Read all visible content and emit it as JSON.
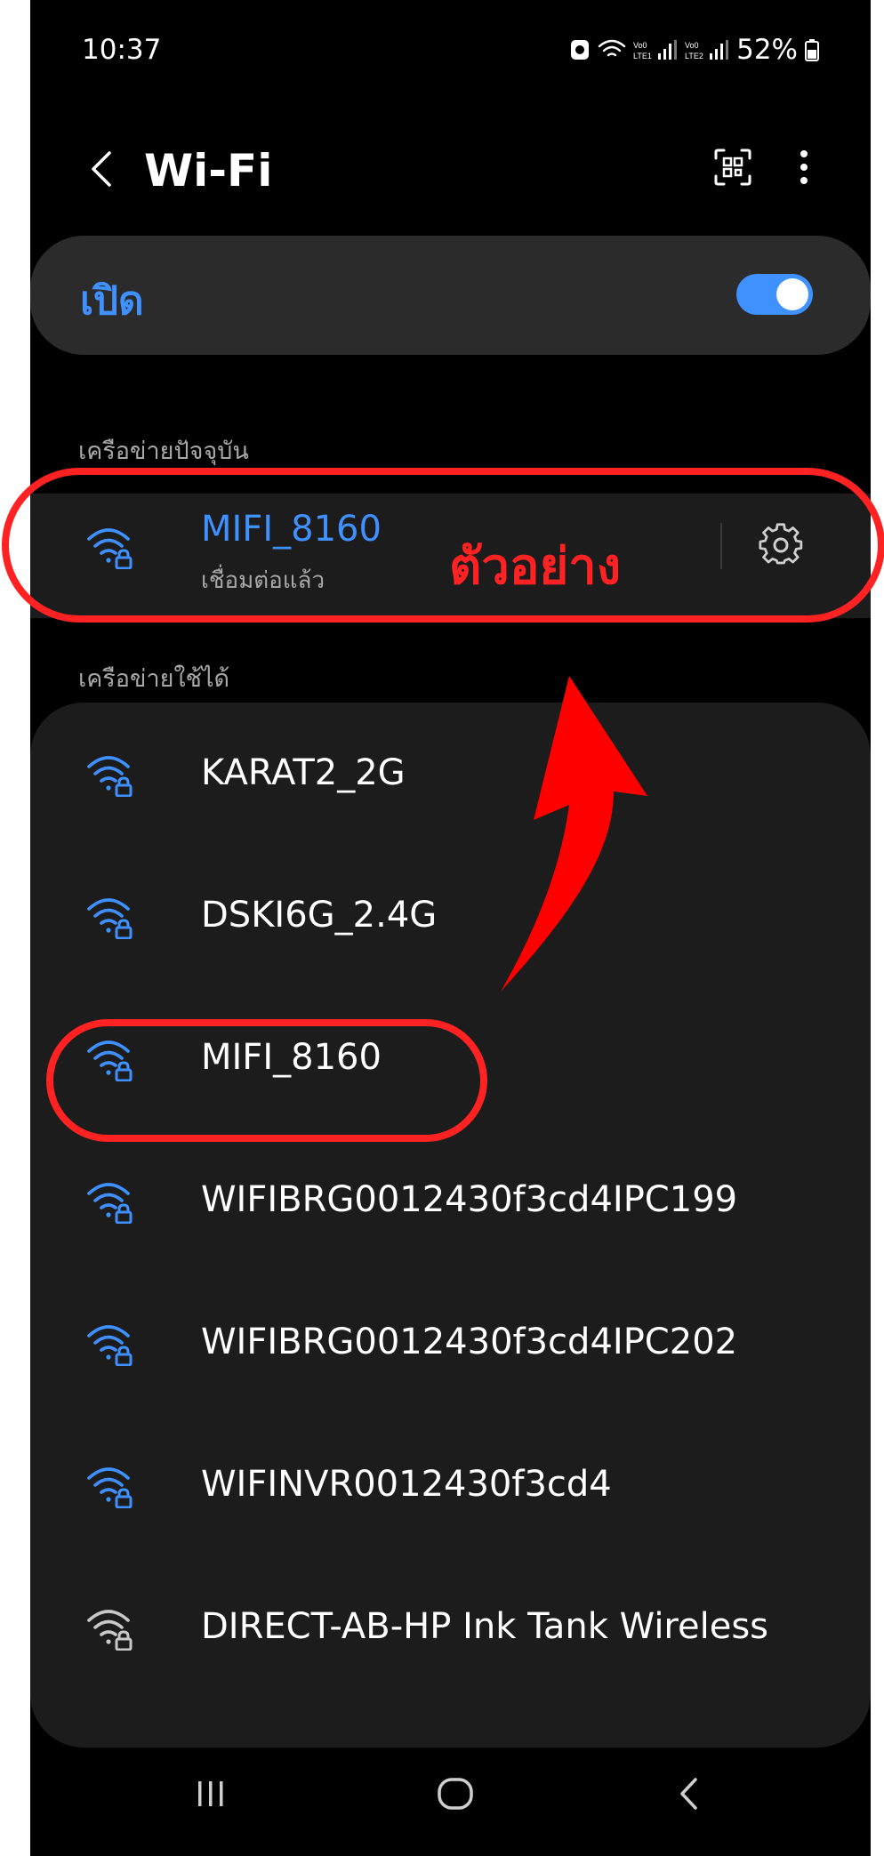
{
  "status_bar": {
    "time": "10:37",
    "battery": "52%",
    "icons": [
      "notification-icon",
      "wifi-signal-icon",
      "lte1-signal-icon",
      "lte2-signal-icon",
      "battery-icon"
    ]
  },
  "header": {
    "title": "Wi-Fi",
    "back_icon": "back-chevron-icon",
    "qr_icon": "qr-scan-icon",
    "more_icon": "more-vert-icon"
  },
  "wifi_toggle": {
    "label": "เปิด",
    "on": true
  },
  "current_network": {
    "section_label": "เครือข่ายปัจจุบัน",
    "name": "MIFI_8160",
    "status": "เชื่อมต่อแล้ว",
    "settings_icon": "gear-icon"
  },
  "available_networks": {
    "section_label": "เครือข่ายใช้ได้",
    "items": [
      {
        "name": "KARAT2_2G",
        "icon": "wifi-lock-icon"
      },
      {
        "name": "DSKI6G_2.4G",
        "icon": "wifi-lock-icon"
      },
      {
        "name": "MIFI_8160",
        "icon": "wifi-lock-icon"
      },
      {
        "name": "WIFIBRG0012430f3cd4IPC199",
        "icon": "wifi-lock-icon"
      },
      {
        "name": "WIFIBRG0012430f3cd4IPC202",
        "icon": "wifi-lock-icon"
      },
      {
        "name": "WIFINVR0012430f3cd4",
        "icon": "wifi-lock-icon"
      },
      {
        "name": "DIRECT-AB-HP Ink Tank Wireless",
        "icon": "wifi-lock-icon"
      }
    ]
  },
  "annotation": {
    "label": "ตัวอย่าง",
    "color": "#ff2222"
  },
  "nav_bar": {
    "recent_icon": "recent-apps-icon",
    "home_icon": "home-icon",
    "back_icon": "nav-back-icon"
  },
  "colors": {
    "accent": "#3e91ff",
    "background": "#000000",
    "card": "#1c1c1c",
    "annotation": "#ff2222"
  }
}
